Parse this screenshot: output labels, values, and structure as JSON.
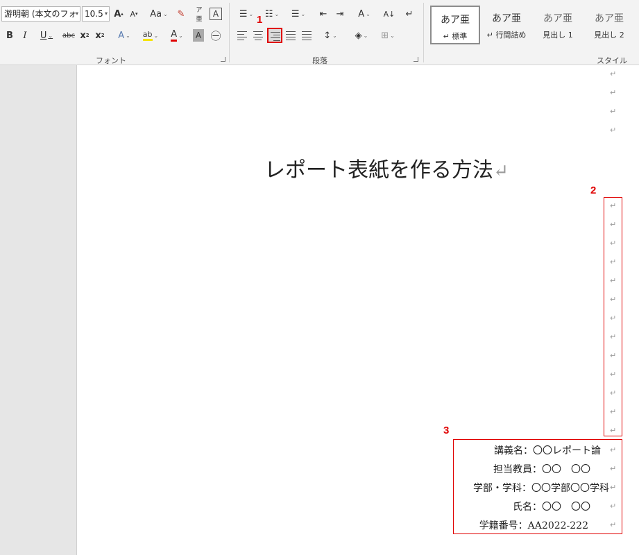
{
  "ribbon": {
    "font_group": {
      "label": "フォント",
      "font_name": "游明朝 (本文のフォ",
      "font_size": "10.5",
      "grow_font": "A",
      "shrink_font": "A",
      "change_case": "Aa",
      "bold": "B",
      "italic": "I",
      "underline": "U",
      "strikethrough": "abc",
      "subscript": "x",
      "superscript": "x",
      "font_color_letter": "A",
      "char_shading_letter": "A"
    },
    "paragraph_group": {
      "label": "段落"
    },
    "styles_group": {
      "label": "スタイル",
      "items": [
        {
          "sample": "あア亜",
          "name": "↵ 標準"
        },
        {
          "sample": "あア亜",
          "name": "↵ 行間詰め"
        },
        {
          "sample": "あア亜",
          "name": "見出し 1"
        },
        {
          "sample": "あア亜",
          "name": "見出し 2"
        }
      ]
    }
  },
  "annotations": {
    "a1": "1",
    "a2": "2",
    "a3": "3"
  },
  "document": {
    "paragraph_mark": "↵",
    "title": "レポート表紙を作る方法",
    "info_lines": [
      "講義名：〇〇レポート論",
      "担当教員：〇〇　〇〇",
      "学部・学科：〇〇学部〇〇学科",
      "氏名：〇〇　〇〇",
      "学籍番号：AA2022-222"
    ]
  },
  "colors": {
    "annotation_red": "#e00000",
    "ribbon_bg": "#f3f3f3"
  }
}
